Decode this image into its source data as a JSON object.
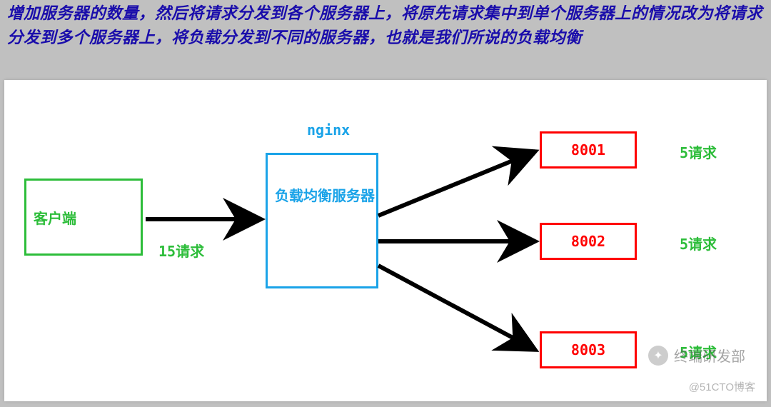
{
  "intro_text": "增加服务器的数量，然后将请求分发到各个服务器上，将原先请求集中到单个服务器上的情况改为将请求分发到多个服务器上，将负载分发到不同的服务器，也就是我们所说的负载均衡",
  "diagram": {
    "client_label": "客户端",
    "nginx_caption": "nginx",
    "loadbalancer_label": "负载均衡服务器",
    "client_requests_label": "15请求",
    "servers": [
      {
        "port": "8001",
        "req": "5请求"
      },
      {
        "port": "8002",
        "req": "5请求"
      },
      {
        "port": "8003",
        "req": "5请求"
      }
    ]
  },
  "watermark": {
    "channel": "终端研发部",
    "source": "@51CTO博客"
  }
}
